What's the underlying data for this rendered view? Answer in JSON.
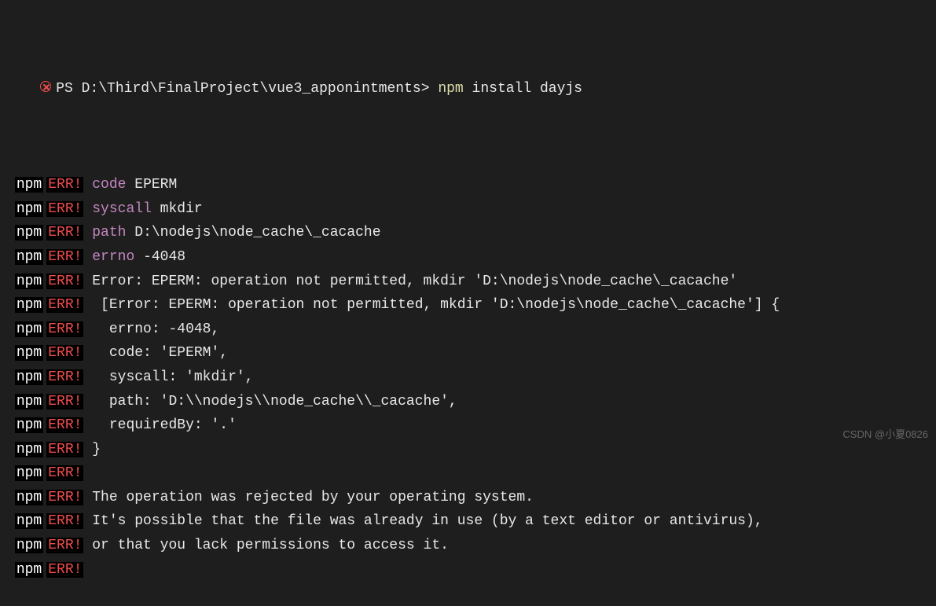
{
  "prompt": {
    "icon": "error-icon",
    "ps": "PS",
    "path": "D:\\Third\\FinalProject\\vue3_apponintments>",
    "cmd_name": "npm",
    "cmd_args": "install dayjs"
  },
  "tags": {
    "npm": "npm",
    "err": "ERR!"
  },
  "lines": [
    {
      "kind": "kv",
      "key": "code",
      "val": " EPERM"
    },
    {
      "kind": "kv",
      "key": "syscall",
      "val": " mkdir"
    },
    {
      "kind": "kv",
      "key": "path",
      "val": " D:\\nodejs\\node_cache\\_cacache"
    },
    {
      "kind": "kv",
      "key": "errno",
      "val": " -4048"
    },
    {
      "kind": "text",
      "val": "Error: EPERM: operation not permitted, mkdir 'D:\\nodejs\\node_cache\\_cacache'"
    },
    {
      "kind": "text",
      "val": " [Error: EPERM: operation not permitted, mkdir 'D:\\nodejs\\node_cache\\_cacache'] {"
    },
    {
      "kind": "text",
      "val": "  errno: -4048,"
    },
    {
      "kind": "text",
      "val": "  code: 'EPERM',"
    },
    {
      "kind": "text",
      "val": "  syscall: 'mkdir',"
    },
    {
      "kind": "text",
      "val": "  path: 'D:\\\\nodejs\\\\node_cache\\\\_cacache',"
    },
    {
      "kind": "text",
      "val": "  requiredBy: '.'"
    },
    {
      "kind": "text",
      "val": "}"
    },
    {
      "kind": "text",
      "val": ""
    },
    {
      "kind": "text",
      "val": "The operation was rejected by your operating system."
    },
    {
      "kind": "text",
      "val": "It's possible that the file was already in use (by a text editor or antivirus),"
    },
    {
      "kind": "text",
      "val": "or that you lack permissions to access it."
    },
    {
      "kind": "text",
      "val": ""
    }
  ],
  "watermark": "CSDN @小夏0826"
}
